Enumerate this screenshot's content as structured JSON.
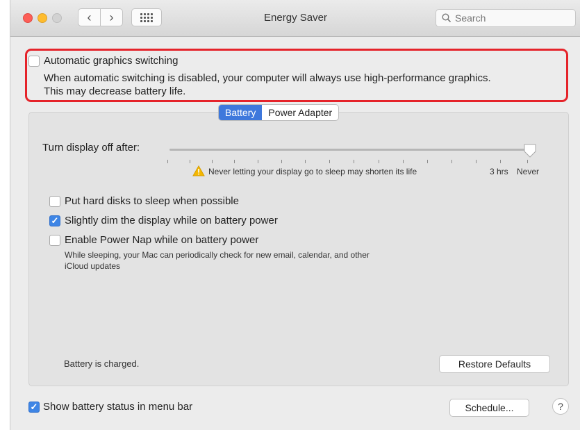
{
  "window": {
    "title": "Energy Saver",
    "search_placeholder": "Search"
  },
  "graphics": {
    "checkbox_label": "Automatic graphics switching",
    "checked": false,
    "description_line1": "When automatic switching is disabled, your computer will always use high-performance graphics.",
    "description_line2": "This may decrease battery life."
  },
  "tabs": [
    {
      "label": "Battery",
      "active": true
    },
    {
      "label": "Power Adapter",
      "active": false
    }
  ],
  "display_sleep": {
    "label": "Turn display off after:",
    "warning_text": "Never letting your display go to sleep may shorten its life",
    "tick_label_3hrs": "3 hrs",
    "tick_label_never": "Never",
    "selected_value": "Never"
  },
  "options": [
    {
      "label": "Put hard disks to sleep when possible",
      "checked": false
    },
    {
      "label": "Slightly dim the display while on battery power",
      "checked": true
    },
    {
      "label": "Enable Power Nap while on battery power",
      "checked": false
    }
  ],
  "power_nap_description": {
    "line1": "While sleeping, your Mac can periodically check for new email, calendar, and other",
    "line2": "iCloud updates"
  },
  "battery_status": "Battery is charged.",
  "restore_defaults_label": "Restore Defaults",
  "show_battery_status": {
    "label": "Show battery status in menu bar",
    "checked": true
  },
  "schedule_label": "Schedule...",
  "help_label": "?",
  "colors": {
    "accent": "#3e78dc",
    "callout": "#e5232a"
  }
}
